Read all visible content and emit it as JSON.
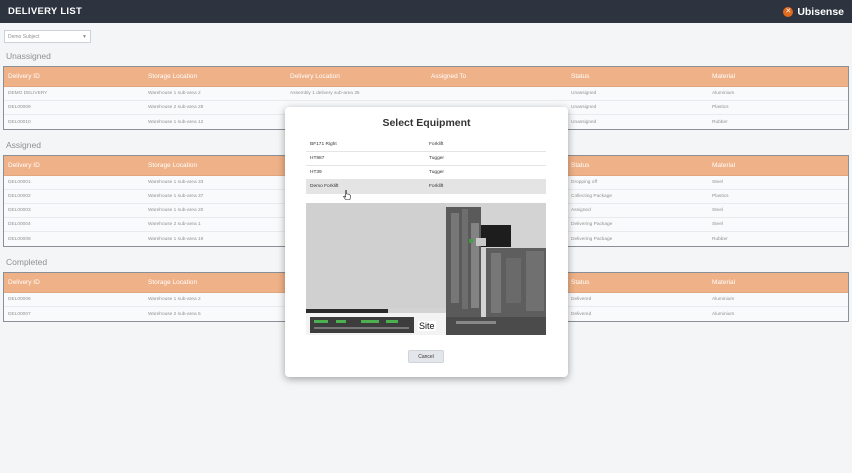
{
  "app": {
    "title": "DELIVERY LIST",
    "brand": "Ubisense",
    "brand_icon": "ubisense-logo-icon"
  },
  "subject_select": {
    "value": "Demo Subject"
  },
  "columns": [
    "Delivery ID",
    "Storage Location",
    "Delivery Location",
    "Assigned To",
    "Status",
    "Material"
  ],
  "sections": [
    {
      "title": "Unassigned",
      "rows": [
        [
          "DEMO DELIVERY",
          "Warehouse 1 sub-area 2",
          "Assembly 1 delivery sub-area 35",
          "",
          "Unassigned",
          "Aluminium"
        ],
        [
          "DEL00009",
          "Warehouse 2 sub-area 28",
          "",
          "",
          "Unassigned",
          "Plastics"
        ],
        [
          "DEL00010",
          "Warehouse 1 sub-area 12",
          "",
          "",
          "Unassigned",
          "Rubber"
        ]
      ]
    },
    {
      "title": "Assigned",
      "rows": [
        [
          "DEL00001",
          "Warehouse 1 sub-area 33",
          "",
          "",
          "Dropping off",
          "Steel"
        ],
        [
          "DEL00002",
          "Warehouse 1 sub-area 37",
          "",
          "",
          "Collecting Package",
          "Plastics"
        ],
        [
          "DEL00003",
          "Warehouse 1 sub-area 20",
          "",
          "",
          "Assigned",
          "Steel"
        ],
        [
          "DEL00004",
          "Warehouse 2 sub-area 1",
          "",
          "",
          "Delivering Package",
          "Steel"
        ],
        [
          "DEL00008",
          "Warehouse 1 sub-area 19",
          "",
          "",
          "Delivering Package",
          "Rubber"
        ]
      ]
    },
    {
      "title": "Completed",
      "rows": [
        [
          "DEL00006",
          "Warehouse 1 sub-area 2",
          "",
          "",
          "Delivered",
          "Aluminium"
        ],
        [
          "DEL00007",
          "Warehouse 2 sub-area 5",
          "",
          "",
          "Delivered",
          "Aluminium"
        ]
      ]
    }
  ],
  "modal": {
    "title": "Select Equipment",
    "equipment": [
      {
        "name": "BF171 Right",
        "type": "Forklift"
      },
      {
        "name": "HT987",
        "type": "Tugger"
      },
      {
        "name": "HT39",
        "type": "Tugger"
      },
      {
        "name": "Demo Forklift",
        "type": "Forklift",
        "selected": true
      }
    ],
    "map_label": "Site",
    "cancel_label": "Cancel"
  },
  "colors": {
    "header_bar": "#2d3440",
    "table_header": "#e27126",
    "brand_accent": "#e06a1e"
  }
}
